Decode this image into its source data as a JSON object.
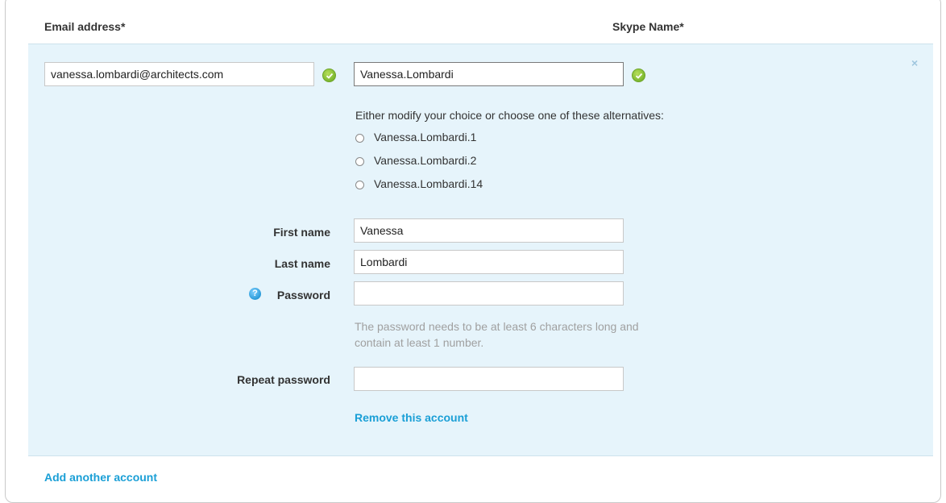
{
  "headers": {
    "email": "Email address*",
    "skype": "Skype Name*"
  },
  "account": {
    "email_value": "vanessa.lombardi@architects.com",
    "skype_value": "Vanessa.Lombardi",
    "close_glyph": "×",
    "alternatives_note": "Either modify your choice or choose one of these alternatives:",
    "alternatives": [
      "Vanessa.Lombardi.1",
      "Vanessa.Lombardi.2",
      "Vanessa.Lombardi.14"
    ],
    "first_name_label": "First name",
    "first_name_value": "Vanessa",
    "last_name_label": "Last name",
    "last_name_value": "Lombardi",
    "password_label": "Password",
    "help_glyph": "?",
    "password_hint_line1": "The password needs to be at least 6 characters long and",
    "password_hint_line2": "contain at least 1 number.",
    "repeat_password_label": "Repeat password",
    "remove_link": "Remove this account"
  },
  "footer": {
    "add_link": "Add another account"
  },
  "colors": {
    "panel_bg": "#e6f4fb",
    "link": "#1a9fd6",
    "valid_check": "#7cb82f",
    "hint_text": "#a0a0a0"
  }
}
